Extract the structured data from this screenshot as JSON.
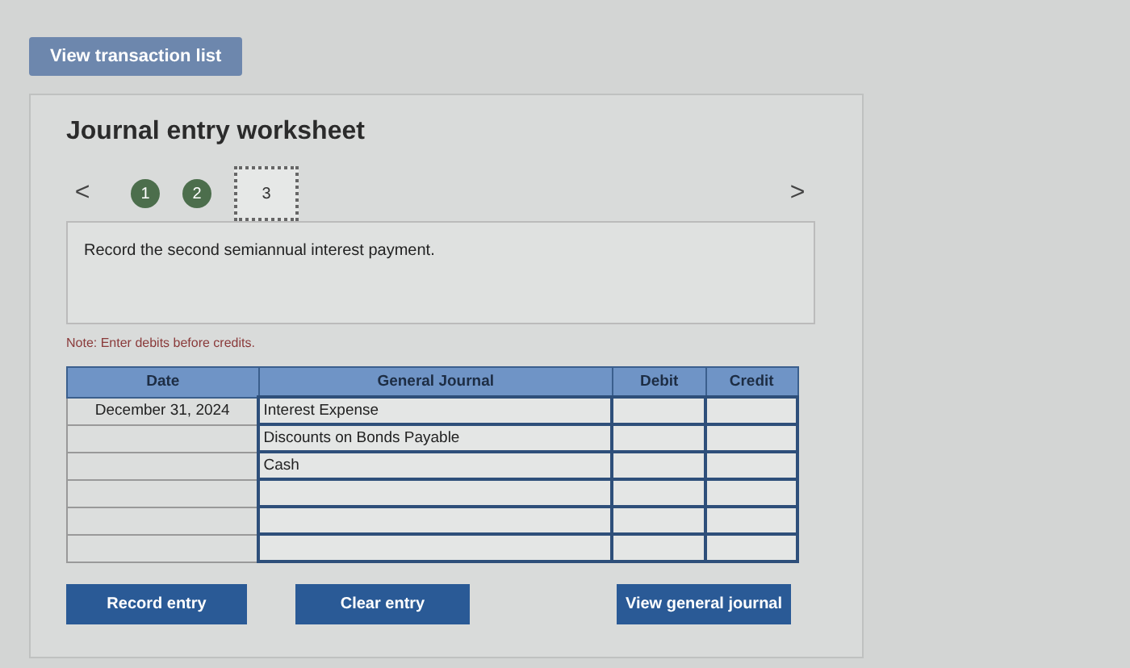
{
  "top_button": "View transaction list",
  "worksheet": {
    "title": "Journal entry worksheet",
    "prev": "<",
    "next": ">",
    "steps": [
      {
        "label": "1",
        "done": true,
        "selected": false
      },
      {
        "label": "2",
        "done": true,
        "selected": false
      },
      {
        "label": "3",
        "done": false,
        "selected": true
      }
    ],
    "prompt": "Record the second semiannual interest payment.",
    "note": "Note: Enter debits before credits.",
    "table": {
      "columns": [
        "Date",
        "General Journal",
        "Debit",
        "Credit"
      ],
      "rows": [
        {
          "date": "December 31, 2024",
          "account": "Interest Expense"
        },
        {
          "account": "Discounts on Bonds Payable"
        },
        {
          "account": "Cash"
        },
        {},
        {},
        {}
      ]
    },
    "buttons": [
      "Record entry",
      "Clear entry",
      "View general journal"
    ]
  }
}
